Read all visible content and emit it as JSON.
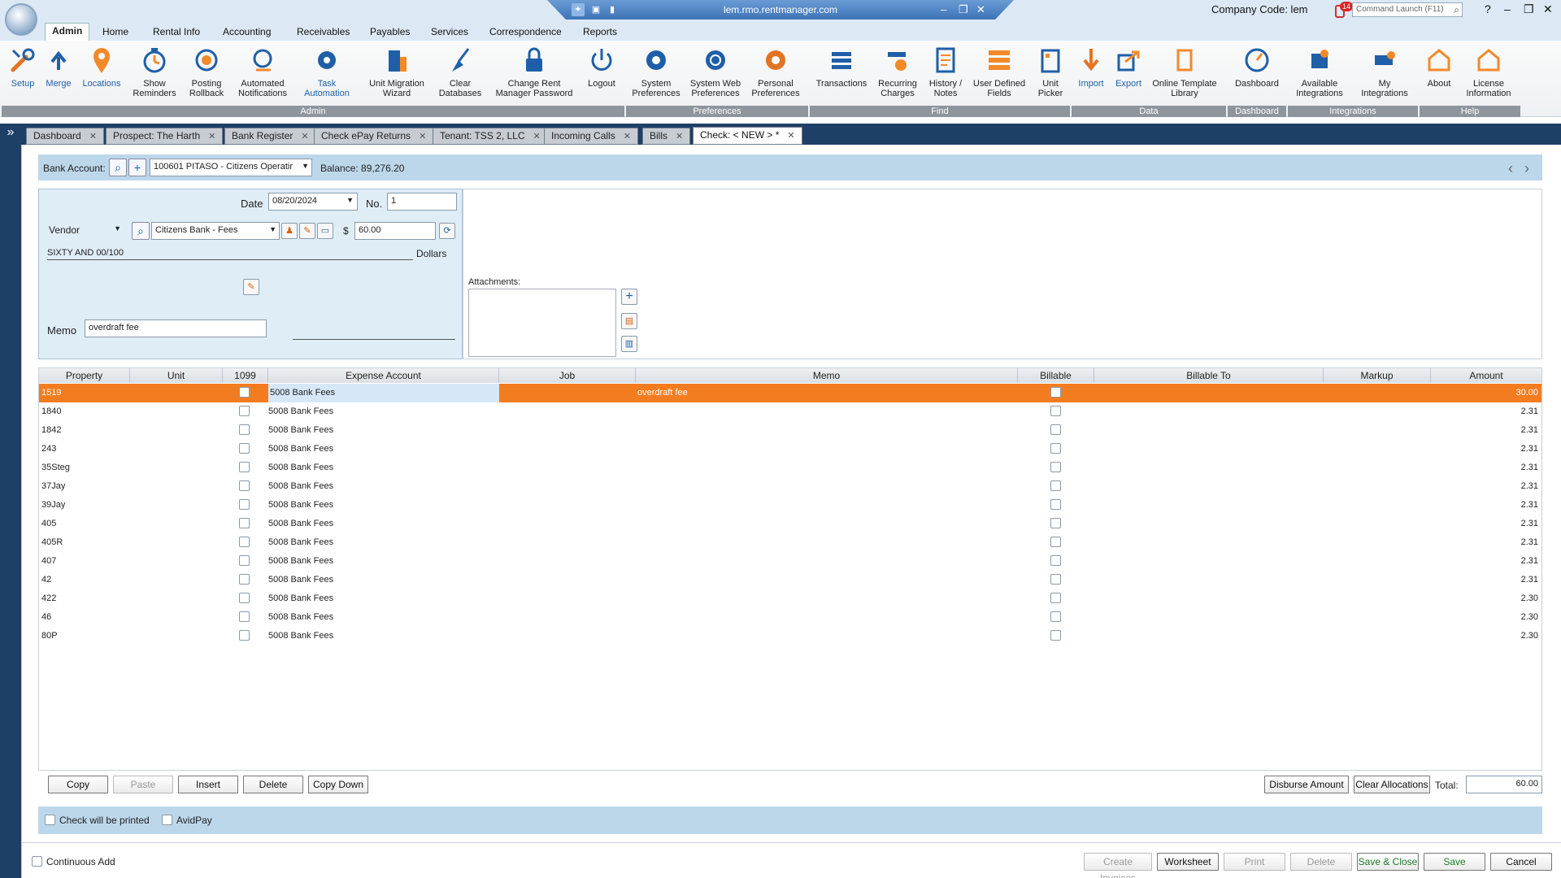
{
  "titlebar": {
    "url": "lem.rmo.rentmanager.com",
    "company_code": "Company Code: lem",
    "notification_count": "14",
    "command_launch_placeholder": "Command Launch (F11)"
  },
  "menu_tabs": [
    "Admin",
    "Home",
    "Rental Info",
    "Accounting",
    "Receivables",
    "Payables",
    "Services",
    "Correspondence",
    "Reports"
  ],
  "ribbon": {
    "buttons": [
      {
        "label": "Setup",
        "icon": "wrench-icon"
      },
      {
        "label": "Merge",
        "icon": "merge-arrows-icon"
      },
      {
        "label": "Locations",
        "icon": "map-pin-icon"
      },
      {
        "label": "Show\nReminders",
        "icon": "stopwatch-icon"
      },
      {
        "label": "Posting\nRollback",
        "icon": "rollback-icon"
      },
      {
        "label": "Automated\nNotifications",
        "icon": "notification-icon"
      },
      {
        "label": "Task\nAutomation",
        "icon": "gear-icon"
      },
      {
        "label": "Unit Migration\nWizard",
        "icon": "building-icon"
      },
      {
        "label": "Clear\nDatabases",
        "icon": "broom-icon"
      },
      {
        "label": "Change Rent\nManager Password",
        "icon": "lock-icon"
      },
      {
        "label": "Logout",
        "icon": "power-icon"
      },
      {
        "label": "System\nPreferences",
        "icon": "gear-icon"
      },
      {
        "label": "System Web\nPreferences",
        "icon": "gear-web-icon"
      },
      {
        "label": "Personal\nPreferences",
        "icon": "gear-person-icon"
      },
      {
        "label": "Transactions",
        "icon": "stack-icon"
      },
      {
        "label": "Recurring\nCharges",
        "icon": "recurring-icon"
      },
      {
        "label": "History /\nNotes",
        "icon": "notes-icon"
      },
      {
        "label": "User Defined\nFields",
        "icon": "fields-icon"
      },
      {
        "label": "Unit\nPicker",
        "icon": "unit-picker-icon"
      },
      {
        "label": "Import",
        "icon": "import-icon"
      },
      {
        "label": "Export",
        "icon": "export-icon"
      },
      {
        "label": "Online Template\nLibrary",
        "icon": "template-icon"
      },
      {
        "label": "Dashboard",
        "icon": "gauge-icon"
      },
      {
        "label": "Available\nIntegrations",
        "icon": "puzzle-icon"
      },
      {
        "label": "My\nIntegrations",
        "icon": "puzzle-star-icon"
      },
      {
        "label": "About",
        "icon": "about-icon"
      },
      {
        "label": "License\nInformation",
        "icon": "license-icon"
      }
    ],
    "groups": [
      "Admin",
      "Preferences",
      "Find",
      "Data",
      "Dashboard",
      "Integrations",
      "Help"
    ]
  },
  "doc_tabs": [
    "Dashboard",
    "Prospect: The Harth",
    "Bank Register",
    "Check ePay Returns",
    "Tenant: TSS 2, LLC",
    "Incoming Calls",
    "Bills",
    "Check: < NEW > *"
  ],
  "bank": {
    "label": "Bank Account:",
    "account": "100601 PITASO - Citizens Operatir",
    "balance": "Balance:  89,276.20"
  },
  "check": {
    "date_label": "Date",
    "date": "08/20/2024",
    "no_label": "No.",
    "no": "1",
    "payee_type": "Vendor",
    "payee": "Citizens Bank - Fees",
    "dollar_sign": "$",
    "amount": "60.00",
    "amount_words": "SIXTY AND 00/100",
    "dollars_label": "Dollars",
    "memo_label": "Memo",
    "memo": "overdraft fee"
  },
  "attachments_label": "Attachments:",
  "grid": {
    "headers": [
      "Property",
      "Unit",
      "1099",
      "Expense Account",
      "Job",
      "Memo",
      "Billable",
      "Billable To",
      "Markup",
      "Amount"
    ],
    "rows": [
      {
        "property": "1519",
        "account": "5008 Bank Fees",
        "memo": "overdraft fee",
        "amount": "30.00"
      },
      {
        "property": "1840",
        "account": "5008 Bank Fees",
        "memo": "",
        "amount": "2.31"
      },
      {
        "property": "1842",
        "account": "5008 Bank Fees",
        "memo": "",
        "amount": "2.31"
      },
      {
        "property": "243",
        "account": "5008 Bank Fees",
        "memo": "",
        "amount": "2.31"
      },
      {
        "property": "35Steg",
        "account": "5008 Bank Fees",
        "memo": "",
        "amount": "2.31"
      },
      {
        "property": "37Jay",
        "account": "5008 Bank Fees",
        "memo": "",
        "amount": "2.31"
      },
      {
        "property": "39Jay",
        "account": "5008 Bank Fees",
        "memo": "",
        "amount": "2.31"
      },
      {
        "property": "405",
        "account": "5008 Bank Fees",
        "memo": "",
        "amount": "2.31"
      },
      {
        "property": "405R",
        "account": "5008 Bank Fees",
        "memo": "",
        "amount": "2.31"
      },
      {
        "property": "407",
        "account": "5008 Bank Fees",
        "memo": "",
        "amount": "2.31"
      },
      {
        "property": "42",
        "account": "5008 Bank Fees",
        "memo": "",
        "amount": "2.31"
      },
      {
        "property": "422",
        "account": "5008 Bank Fees",
        "memo": "",
        "amount": "2.30"
      },
      {
        "property": "46",
        "account": "5008 Bank Fees",
        "memo": "",
        "amount": "2.30"
      },
      {
        "property": "80P",
        "account": "5008 Bank Fees",
        "memo": "",
        "amount": "2.30"
      }
    ]
  },
  "grid_actions": {
    "copy": "Copy",
    "paste": "Paste",
    "insert": "Insert",
    "delete": "Delete",
    "copy_down": "Copy Down",
    "disburse": "Disburse Amount",
    "clear_alloc": "Clear Allocations",
    "total_label": "Total:",
    "total": "60.00"
  },
  "print_options": {
    "check_printed": "Check will be printed",
    "avidpay": "AvidPay"
  },
  "footer": {
    "continuous_add": "Continuous Add",
    "create_invoices": "Create Invoices",
    "worksheet": "Worksheet",
    "print": "Print",
    "delete": "Delete",
    "save_close": "Save & Close",
    "save": "Save",
    "cancel": "Cancel"
  },
  "colors": {
    "accent_orange": "#f47c20",
    "panel_blue": "#bcd7ea",
    "tab_navy": "#1e3f66",
    "icon_blue": "#1f5fa8"
  }
}
